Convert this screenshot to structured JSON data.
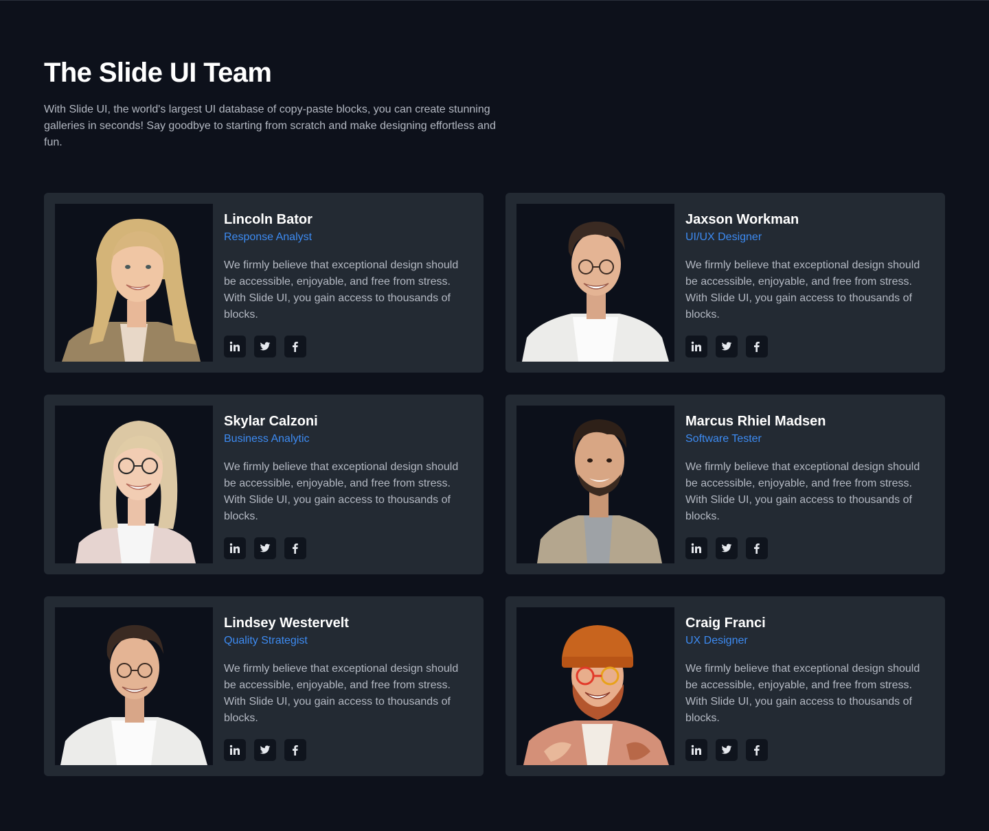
{
  "header": {
    "title": "The Slide UI Team",
    "subtitle": "With Slide UI, the world's largest UI database of copy-paste blocks, you can create stunning galleries in seconds! Say goodbye to starting from scratch and make designing effortless and fun."
  },
  "colors": {
    "background": "#0d111b",
    "card": "#232a33",
    "accent": "#3d8bf2",
    "muted_text": "#b4b9c3",
    "icon_bg": "#0f141d"
  },
  "social_icons": [
    "linkedin-icon",
    "twitter-icon",
    "facebook-icon"
  ],
  "team": [
    {
      "name": "Lincoln Bator",
      "role": "Response Analyst",
      "bio": "We firmly believe that exceptional design should be accessible, enjoyable, and free from stress. With Slide UI, you gain access to thousands of blocks.",
      "photo": "portrait-blonde-woman"
    },
    {
      "name": "Jaxson Workman",
      "role": "UI/UX Designer",
      "bio": "We firmly believe that exceptional design should be accessible, enjoyable, and free from stress. With Slide UI, you gain access to thousands of blocks.",
      "photo": "portrait-man-glasses"
    },
    {
      "name": "Skylar Calzoni",
      "role": "Business Analytic",
      "bio": "We firmly believe that exceptional design should be accessible, enjoyable, and free from stress. With Slide UI, you gain access to thousands of blocks.",
      "photo": "portrait-woman-glasses"
    },
    {
      "name": "Marcus Rhiel Madsen",
      "role": "Software Tester",
      "bio": "We firmly believe that exceptional design should be accessible, enjoyable, and free from stress. With Slide UI, you gain access to thousands of blocks.",
      "photo": "portrait-man-jacket"
    },
    {
      "name": "Lindsey Westervelt",
      "role": "Quality Strategist",
      "bio": "We firmly believe that exceptional design should be accessible, enjoyable, and free from stress. With Slide UI, you gain access to thousands of blocks.",
      "photo": "portrait-man-glasses"
    },
    {
      "name": "Craig Franci",
      "role": "UX Designer",
      "bio": "We firmly believe that exceptional design should be accessible, enjoyable, and free from stress. With Slide UI, you gain access to thousands of blocks.",
      "photo": "portrait-man-beanie"
    }
  ]
}
